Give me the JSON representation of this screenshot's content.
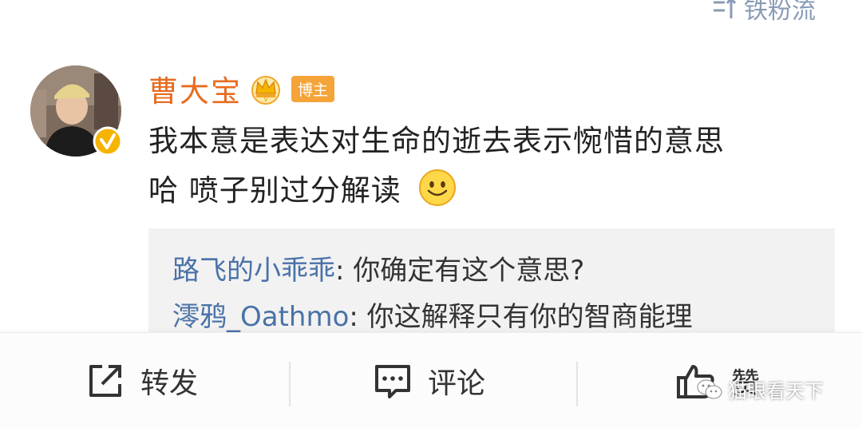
{
  "header": {
    "follow_label": "铁粉流"
  },
  "post": {
    "username": "曹大宝",
    "badge": "博主",
    "text_line1": "我本意是表达对生命的逝去表示惋惜的意思",
    "text_line2": "哈 喷子别过分解读"
  },
  "replies": [
    {
      "name": "路飞的小乖乖",
      "text": ": 你确定有这个意思?"
    },
    {
      "name": "澪鸦_Oathmo",
      "text": ": 你这解释只有你的智商能理"
    }
  ],
  "actions": {
    "repost_label": "转发",
    "comment_label": "评论",
    "like_label": "赞"
  },
  "watermark": {
    "text": "猫眼看天下"
  },
  "colors": {
    "username": "#e86b1f",
    "reply_name": "#4a72a8",
    "badge_bg": "#f5a43a",
    "verified": "#f5b400"
  }
}
